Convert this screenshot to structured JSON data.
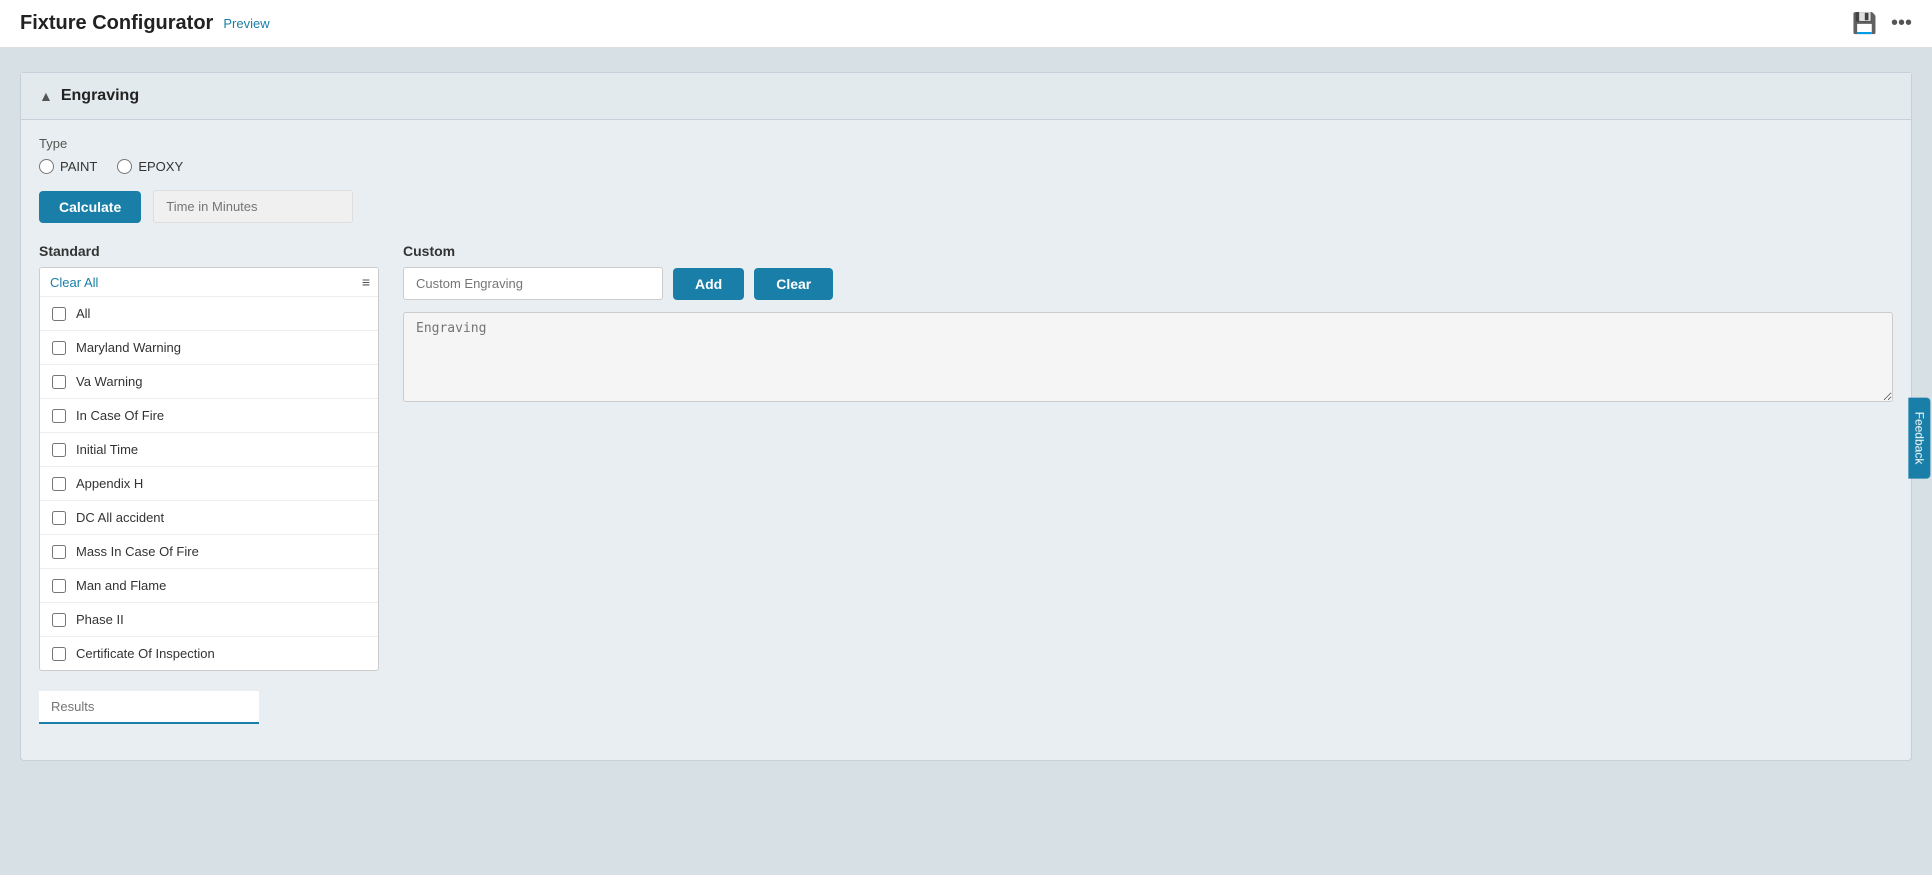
{
  "header": {
    "title": "Fixture Configurator",
    "preview_label": "Preview",
    "save_icon": "💾",
    "more_icon": "⋯"
  },
  "feedback": {
    "label": "Feedback"
  },
  "panel": {
    "title": "Engraving",
    "chevron": "▲"
  },
  "type_section": {
    "label": "Type",
    "options": [
      {
        "value": "paint",
        "label": "PAINT"
      },
      {
        "value": "epoxy",
        "label": "EPOXY"
      }
    ]
  },
  "calculate": {
    "button_label": "Calculate",
    "time_placeholder": "Time in Minutes"
  },
  "standard": {
    "title": "Standard",
    "clear_all_label": "Clear All",
    "items": [
      {
        "id": "all",
        "label": "All",
        "checked": false
      },
      {
        "id": "maryland-warning",
        "label": "Maryland Warning",
        "checked": false
      },
      {
        "id": "va-warning",
        "label": "Va Warning",
        "checked": false
      },
      {
        "id": "in-case-of-fire",
        "label": "In Case Of Fire",
        "checked": false
      },
      {
        "id": "initial-time",
        "label": "Initial Time",
        "checked": false
      },
      {
        "id": "appendix-h",
        "label": "Appendix H",
        "checked": false
      },
      {
        "id": "dc-all-accident",
        "label": "DC All accident",
        "checked": false
      },
      {
        "id": "mass-in-case-of-fire",
        "label": "Mass In Case Of Fire",
        "checked": false
      },
      {
        "id": "man-and-flame",
        "label": "Man and Flame",
        "checked": false
      },
      {
        "id": "phase-ii",
        "label": "Phase II",
        "checked": false
      },
      {
        "id": "certificate-of-inspection",
        "label": "Certificate Of Inspection",
        "checked": false
      }
    ]
  },
  "custom": {
    "title": "Custom",
    "input_placeholder": "Custom Engraving",
    "add_label": "Add",
    "clear_label": "Clear",
    "engraving_placeholder": "Engraving"
  },
  "results": {
    "placeholder": "Results"
  }
}
